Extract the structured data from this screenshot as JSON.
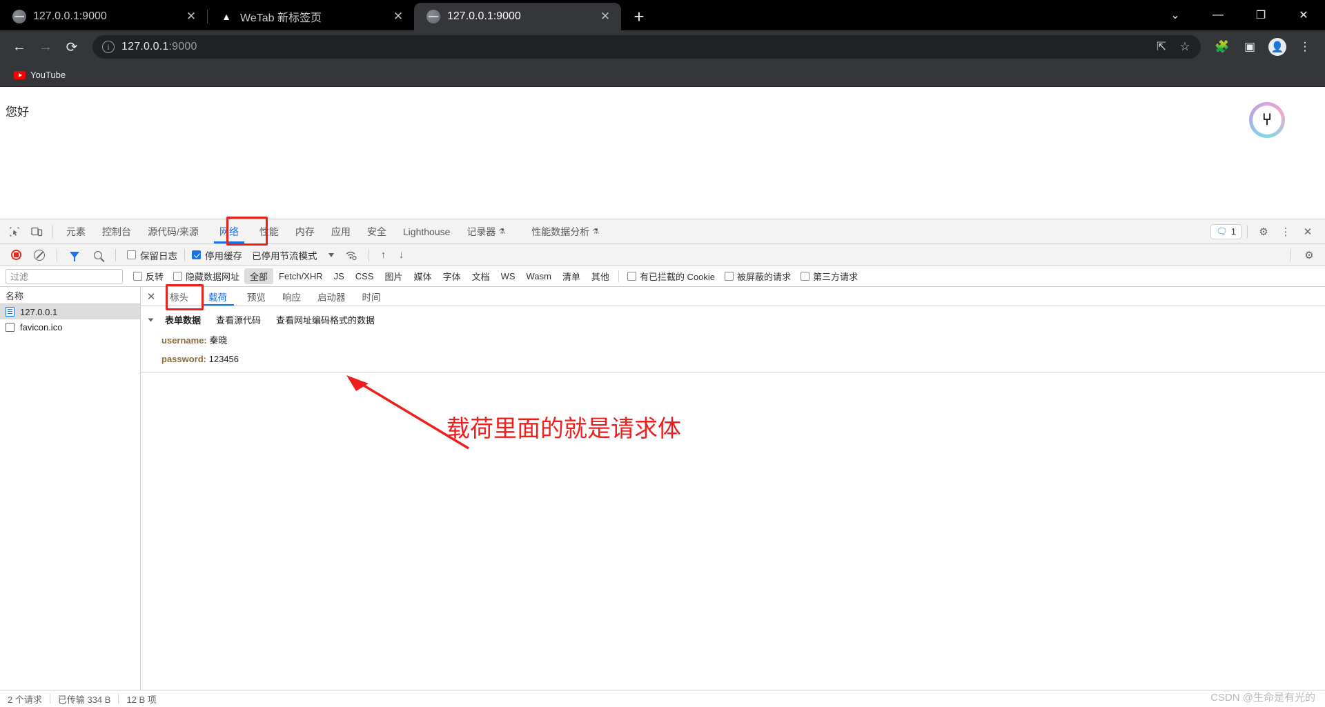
{
  "browser": {
    "tabs": [
      {
        "title": "127.0.0.1:9000",
        "icon": "globe-icon",
        "active": false
      },
      {
        "title": "WeTab 新标签页",
        "icon": "wetab-icon",
        "active": false
      },
      {
        "title": "127.0.0.1:9000",
        "icon": "globe-icon",
        "active": true
      }
    ],
    "new_tab_label": "+",
    "window_controls": {
      "tab_search": "⌄",
      "minimize": "—",
      "maximize": "❐",
      "close": "✕"
    },
    "nav": {
      "back": "←",
      "forward": "→",
      "reload": "⟳"
    },
    "omnibox": {
      "host": "127.0.0.1",
      "port": ":9000",
      "site_info_icon": "ⓘ",
      "share_icon": "↪",
      "bookmark_icon": "☆"
    },
    "toolbar_icons": {
      "extensions": "🧩",
      "side_panel": "▣",
      "profile": "●",
      "menu": "⋮"
    },
    "bookmarks": [
      {
        "label": "YouTube",
        "icon": "youtube-icon"
      }
    ]
  },
  "page": {
    "greeting": "您好",
    "widget_glyph": "⑂"
  },
  "devtools": {
    "panel_tabs": [
      {
        "label": "元素",
        "active": false
      },
      {
        "label": "控制台",
        "active": false
      },
      {
        "label": "源代码/来源",
        "active": false
      },
      {
        "label": "网络",
        "active": true,
        "highlighted": true
      },
      {
        "label": "性能",
        "active": false
      },
      {
        "label": "内存",
        "active": false
      },
      {
        "label": "应用",
        "active": false
      },
      {
        "label": "安全",
        "active": false
      },
      {
        "label": "Lighthouse",
        "active": false
      },
      {
        "label": "记录器",
        "active": false,
        "beta": "⚗"
      },
      {
        "label": "性能数据分析",
        "active": false,
        "beta": "⚗"
      }
    ],
    "left_icons": {
      "inspect": "inspect-element-icon",
      "device": "device-toolbar-icon"
    },
    "right": {
      "message_count": "1",
      "message_icon": "💬",
      "settings_icon": "⚙",
      "more_icon": "⋮",
      "close_icon": "✕"
    },
    "network_toolbar": {
      "record_tooltip": "record",
      "clear_tooltip": "clear",
      "preserve_log": "保留日志",
      "preserve_log_checked": false,
      "disable_cache": "停用缓存",
      "disable_cache_checked": true,
      "throttling": "已停用节流模式",
      "import_icon": "↑",
      "export_icon": "↓",
      "settings_icon": "⚙"
    },
    "filter_bar": {
      "placeholder": "过滤",
      "invert": "反转",
      "hide_data_urls": "隐藏数据网址",
      "types": [
        "全部",
        "Fetch/XHR",
        "JS",
        "CSS",
        "图片",
        "媒体",
        "字体",
        "文档",
        "WS",
        "Wasm",
        "清单",
        "其他"
      ],
      "active_type": "全部",
      "blocked_cookies": "有已拦截的 Cookie",
      "blocked_requests": "被屏蔽的请求",
      "third_party": "第三方请求"
    },
    "request_list": {
      "header": "名称",
      "rows": [
        {
          "name": "127.0.0.1",
          "icon": "document-icon",
          "selected": true
        },
        {
          "name": "favicon.ico",
          "icon": "box-icon",
          "selected": false
        }
      ]
    },
    "detail_tabs": [
      {
        "label": "标头",
        "active": false
      },
      {
        "label": "载荷",
        "active": true,
        "highlighted": true
      },
      {
        "label": "预览",
        "active": false
      },
      {
        "label": "响应",
        "active": false
      },
      {
        "label": "启动器",
        "active": false
      },
      {
        "label": "时间",
        "active": false
      }
    ],
    "payload": {
      "section_title": "表单数据",
      "view_source": "查看源代码",
      "view_url_encoded": "查看网址编码格式的数据",
      "fields": [
        {
          "key": "username:",
          "value": "秦晓"
        },
        {
          "key": "password:",
          "value": "123456"
        }
      ]
    },
    "annotation": {
      "text": "载荷里面的就是请求体",
      "color": "#f01d1d"
    },
    "status_bar": {
      "requests": "2 个请求",
      "transferred": "已传输 334 B",
      "resources": "12 B 项"
    }
  },
  "watermark": "CSDN @生命是有光的"
}
